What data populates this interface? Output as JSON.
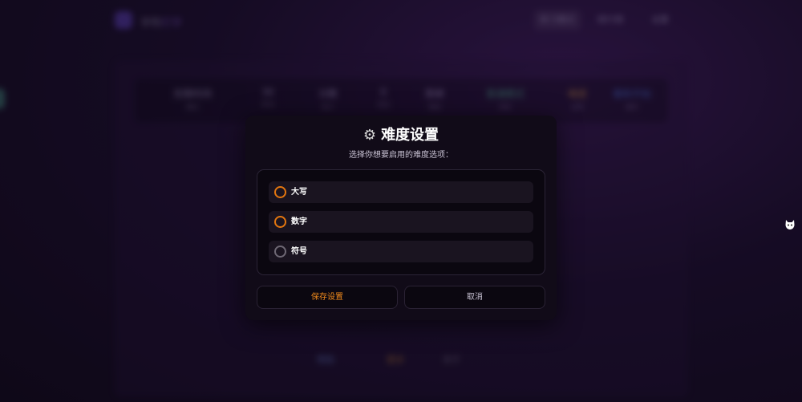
{
  "background": {
    "brand": "字符",
    "brand_accent": "打字",
    "nav": [
      "练习模式",
      "排行榜",
      "设置"
    ],
    "stats": [
      {
        "value": "无限时间",
        "label": "模式"
      },
      {
        "value": "30",
        "label": "单词"
      },
      {
        "value": "分数",
        "label": "统计"
      },
      {
        "value": "0",
        "label": "连击"
      },
      {
        "value": "简单",
        "label": "难度"
      },
      {
        "value": "普通模式",
        "label": "类型"
      },
      {
        "value": "难度",
        "label": "选项"
      },
      {
        "value": "重新开始",
        "label": "操作"
      }
    ],
    "bottom_actions": [
      "帮助",
      "更多",
      "关于"
    ]
  },
  "modal": {
    "title": "难度设置",
    "title_icon": "gear-icon",
    "subtitle": "选择你想要启用的难度选项：",
    "options": [
      {
        "label": "大写",
        "active": true
      },
      {
        "label": "数字",
        "active": true
      },
      {
        "label": "符号",
        "active": false
      }
    ],
    "save_label": "保存设置",
    "cancel_label": "取消"
  },
  "colors": {
    "accent": "#e3760f",
    "modal_bg": "#110b18",
    "option_bg": "#1a1420"
  },
  "floating_helper_icon": "cat-icon"
}
